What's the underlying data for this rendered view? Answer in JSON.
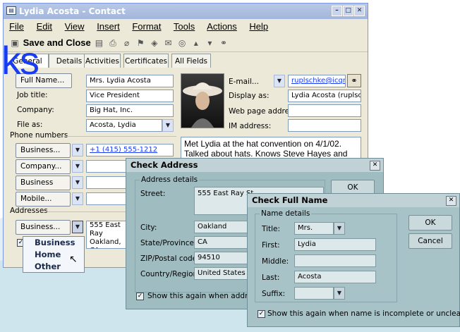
{
  "colors": {
    "accent_blue": "#1a3cf0",
    "dialog_teal": "#9fbcc1",
    "window_bg": "#ece9d8"
  },
  "logo": {
    "text": "ks"
  },
  "contact_window": {
    "title": "Lydia Acosta - Contact",
    "menu": [
      "File",
      "Edit",
      "View",
      "Insert",
      "Format",
      "Tools",
      "Actions",
      "Help"
    ],
    "toolbar": {
      "save_close": "Save and Close"
    },
    "tabs": [
      "General",
      "Details",
      "Activities",
      "Certificates",
      "All Fields"
    ],
    "form": {
      "full_name_btn": "Full Name...",
      "full_name": "Mrs. Lydia Acosta",
      "job_title_label": "Job title:",
      "job_title": "Vice President",
      "company_label": "Company:",
      "company": "Big Hat, Inc.",
      "file_as_label": "File as:",
      "file_as": "Acosta, Lydia",
      "phone_section": "Phone numbers",
      "phones": [
        {
          "label": "Business...",
          "value": "+1 (415) 555-1212"
        },
        {
          "label": "Company...",
          "value": ""
        },
        {
          "label": "Business Fax...",
          "value": ""
        },
        {
          "label": "Mobile...",
          "value": ""
        }
      ],
      "addresses_section": "Addresses",
      "address_type": "Business...",
      "address_value_1": "555 East Ray",
      "address_value_2": "Oakland, CA",
      "email_label": "E-mail...",
      "email": "ruplschke@icqmail.",
      "display_as_label": "Display as:",
      "display_as": "Lydia Acosta (ruplschke",
      "web_label": "Web page address:",
      "web": "",
      "im_label": "IM address:",
      "im": "",
      "notes": "Met Lydia at the hat convention on 4/1/02. Talked about hats. Knows Steve Hayes and"
    },
    "address_dropdown": [
      "Business",
      "Home",
      "Other"
    ]
  },
  "check_address": {
    "title": "Check Address",
    "group": "Address details",
    "street_label": "Street:",
    "street": "555 East Ray St.",
    "city_label": "City:",
    "city": "Oakland",
    "state_label": "State/Province:",
    "state": "CA",
    "zip_label": "ZIP/Postal code:",
    "zip": "94510",
    "country_label": "Country/Region:",
    "country": "United States of A",
    "ok": "OK",
    "show_again": "Show this again when address is inc"
  },
  "check_name": {
    "title": "Check Full Name",
    "group": "Name details",
    "title_label": "Title:",
    "title_value": "Mrs.",
    "first_label": "First:",
    "first": "Lydia",
    "middle_label": "Middle:",
    "middle": "",
    "last_label": "Last:",
    "last": "Acosta",
    "suffix_label": "Suffix:",
    "suffix": "",
    "ok": "OK",
    "cancel": "Cancel",
    "show_again": "Show this again when name is incomplete or unclear"
  }
}
